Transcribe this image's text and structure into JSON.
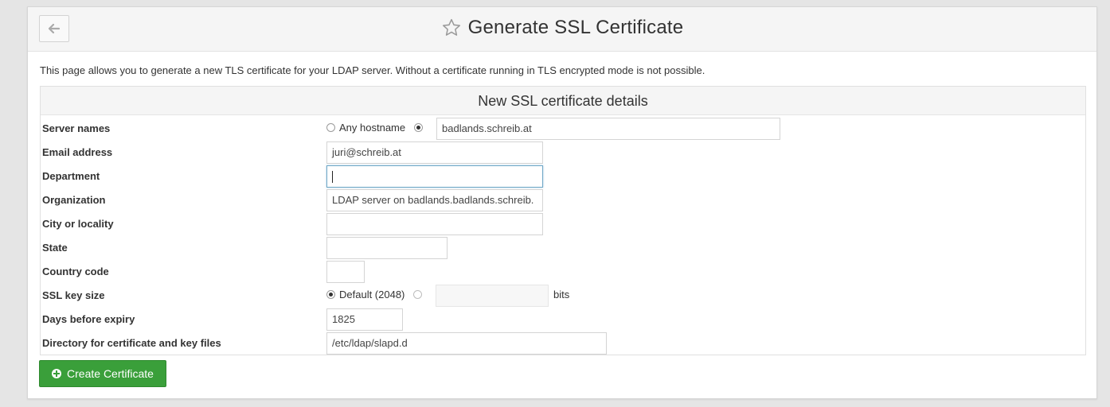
{
  "header": {
    "title": "Generate SSL Certificate",
    "back_icon": "arrow-left-icon",
    "star_icon": "star-outline-icon"
  },
  "intro_text": "This page allows you to generate a new TLS certificate for your LDAP server. Without a certificate running in TLS encrypted mode is not possible.",
  "form": {
    "heading": "New SSL certificate details",
    "server_names": {
      "label": "Server names",
      "any_hostname_label": "Any hostname",
      "value": "badlands.schreib.at"
    },
    "email": {
      "label": "Email address",
      "value": "juri@schreib.at"
    },
    "department": {
      "label": "Department",
      "value": ""
    },
    "organization": {
      "label": "Organization",
      "value": "LDAP server on badlands.badlands.schreib."
    },
    "city": {
      "label": "City or locality",
      "value": ""
    },
    "state": {
      "label": "State",
      "value": ""
    },
    "country": {
      "label": "Country code",
      "value": ""
    },
    "key_size": {
      "label": "SSL key size",
      "default_label": "Default (2048)",
      "custom_value": "",
      "unit": "bits"
    },
    "expiry": {
      "label": "Days before expiry",
      "value": "1825"
    },
    "directory": {
      "label": "Directory for certificate and key files",
      "value": "/etc/ldap/slapd.d"
    }
  },
  "submit": {
    "label": "Create Certificate"
  },
  "colors": {
    "primary_button": "#3a9f3a",
    "focus_border": "#6fa7c6"
  }
}
